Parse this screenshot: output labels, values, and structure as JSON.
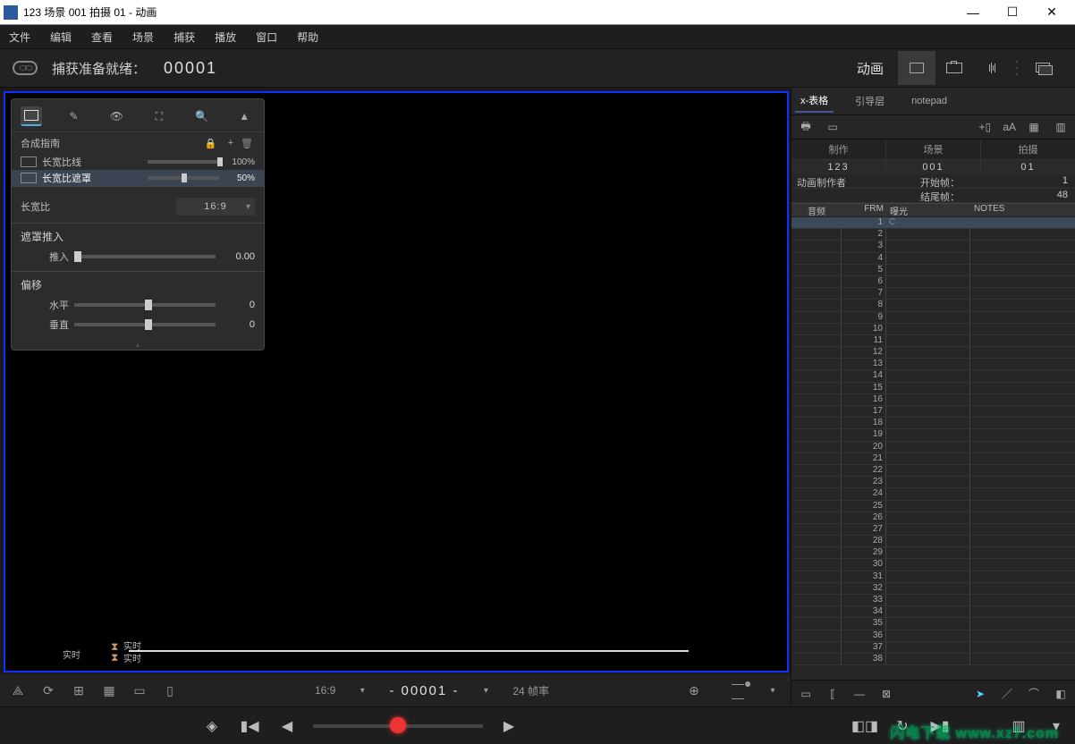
{
  "window": {
    "title": "123 场景 001 拍摄 01 - 动画"
  },
  "menu": {
    "file": "文件",
    "edit": "编辑",
    "view": "查看",
    "scene": "场景",
    "capture": "捕获",
    "playback": "播放",
    "window": "窗口",
    "help": "帮助"
  },
  "header": {
    "capture_ready": "捕获准备就绪：",
    "frame_counter": "00001",
    "mode_label": "动画"
  },
  "panel": {
    "title": "合成指南",
    "row_line": {
      "label": "长宽比线",
      "value": "100%",
      "knob": 98
    },
    "row_mask": {
      "label": "长宽比遮罩",
      "value": "50%",
      "knob": 48
    },
    "aspect": {
      "label": "长宽比",
      "value": "16:9"
    },
    "mask_push": {
      "section": "遮罩推入",
      "label": "推入",
      "value": "0.00",
      "knob": 0
    },
    "offset": {
      "section": "偏移",
      "h": {
        "label": "水平",
        "value": "0",
        "knob": 50
      },
      "v": {
        "label": "垂直",
        "value": "0",
        "knob": 50
      }
    }
  },
  "scrub": {
    "left_label": "实时",
    "top_label": "实时",
    "bottom_label": "实时"
  },
  "vfooter": {
    "aspect": "16:9",
    "frame": "- 00001 -",
    "fps": "24 帧率"
  },
  "right": {
    "tabs": {
      "xsheet": "x-表格",
      "guides": "引导层",
      "notepad": "notepad"
    },
    "text_aA": "aA",
    "meta_headers": {
      "prod": "制作",
      "scene": "场景",
      "shot": "拍摄"
    },
    "meta_values": {
      "prod": "123",
      "scene": "001",
      "shot": "01"
    },
    "animator_label": "动画制作者",
    "start_label": "开始帧：",
    "start_val": "1",
    "end_label": "结尾帧：",
    "end_val": "48",
    "cols": {
      "audio": "音频",
      "frm": "FRM",
      "exposure": "曝光",
      "notes": "NOTES"
    },
    "first_exposure": "C",
    "frame_numbers": [
      1,
      2,
      3,
      4,
      5,
      6,
      7,
      8,
      9,
      10,
      11,
      12,
      13,
      14,
      15,
      16,
      17,
      18,
      19,
      20,
      21,
      22,
      23,
      24,
      25,
      26,
      27,
      28,
      29,
      30,
      31,
      32,
      33,
      34,
      35,
      36,
      37,
      38
    ]
  },
  "watermark": "闪电下载 www.xz7.com"
}
